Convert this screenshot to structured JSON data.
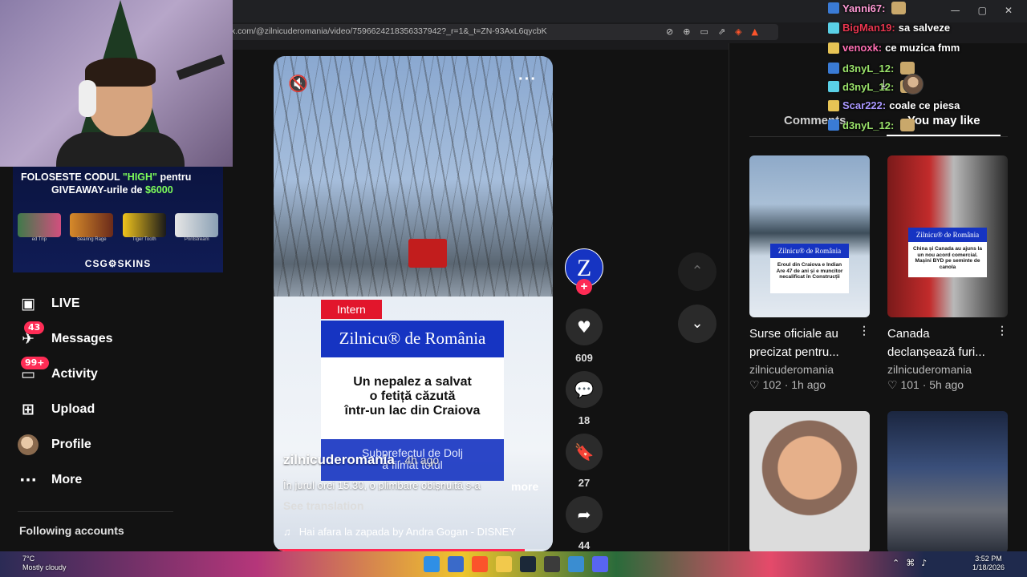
{
  "browser": {
    "url": "k.com/@zilnicuderomania/video/7596624218356337942?_r=1&_t=ZN-93AxL6qycbK",
    "window_controls": [
      "—",
      "▢",
      "✕"
    ]
  },
  "sidebar": {
    "items": [
      {
        "label": "LIVE",
        "icon": "live-tv-icon",
        "glyph": "▣",
        "badge": ""
      },
      {
        "label": "Messages",
        "icon": "messages-icon",
        "glyph": "✈",
        "badge": "43"
      },
      {
        "label": "Activity",
        "icon": "activity-inbox-icon",
        "glyph": "▭",
        "badge": "99+"
      },
      {
        "label": "Upload",
        "icon": "upload-plus-icon",
        "glyph": "⊞",
        "badge": ""
      },
      {
        "label": "Profile",
        "icon": "profile-avatar",
        "glyph": "",
        "badge": ""
      },
      {
        "label": "More",
        "icon": "more-dots-icon",
        "glyph": "···",
        "badge": ""
      }
    ],
    "following_label": "Following accounts"
  },
  "ad": {
    "line1_prefix": "FOLOSESTE CODUL ",
    "line1_code": "\"HIGH\"",
    "line1_suffix": " pentru",
    "line2_prefix": "GIVEAWAY-urile de ",
    "line2_amount": "$6000",
    "weapons": [
      "ed Trip",
      "Searing Rage",
      "Tiger Tooth",
      "Printstream"
    ],
    "logo": "CSG⚙SKINS"
  },
  "video": {
    "tag": "Intern",
    "news_head": "Zilnicu® de România",
    "news_body_1": "Un nepalez a salvat",
    "news_body_2": "o fetiță căzută",
    "news_body_3": "într-un lac din Craiova",
    "news_foot_1": "Subprefectul de Dolj",
    "news_foot_2": "a filmat totul",
    "author": "zilnicuderomania",
    "time": " · 4h ago",
    "description": "În jurul orei 15.30, o plimbare obișnuită s-a",
    "more_label": "more",
    "see_translation": "See translation",
    "music": "Hai afara la zapada by Andra Gogan - DISNEY",
    "progress": 0.9
  },
  "actions": {
    "creator_initial": "Z",
    "likes": "609",
    "comments": "18",
    "saves": "27",
    "shares": "44"
  },
  "panel": {
    "tabs": [
      "Comments",
      "You may like"
    ],
    "recommendations": [
      {
        "title": "Surse oficiale au precizat pentru...",
        "author": "zilnicuderomania",
        "likes": "102",
        "age": "1h ago",
        "mini_head": "Zilnicu® de România",
        "mini_body": "Eroul din Craiova e Indian Are 47 de ani și e muncitor necalificat în Construcții"
      },
      {
        "title": "Canada declanșează furi...",
        "author": "zilnicuderomania",
        "likes": "101",
        "age": "5h ago",
        "mini_head": "Zilnicu® de România",
        "mini_body": "China și Canada au ajuns la un nou acord comercial. Mașini BYD pe seminte de canola"
      }
    ]
  },
  "chat": [
    {
      "user": "Yanni67:",
      "color": "#ff9ad5",
      "msg": ""
    },
    {
      "user": "BigMan19:",
      "color": "#e8364f",
      "msg": "sa salveze"
    },
    {
      "user": "venoxk:",
      "color": "#ff6fb3",
      "msg": "ce muzica fmm"
    },
    {
      "user": "d3nyL_12:",
      "color": "#9be36b",
      "msg": ""
    },
    {
      "user": "d3nyL_12:",
      "color": "#9be36b",
      "msg": ""
    },
    {
      "user": "Scar222:",
      "color": "#a997ff",
      "msg": "coale ce piesa"
    },
    {
      "user": "d3nyL_12:",
      "color": "#9be36b",
      "msg": ""
    }
  ],
  "taskbar": {
    "temp": "7°C",
    "weather": "Mostly cloudy",
    "time": "3:52 PM",
    "date": "1/18/2026"
  }
}
